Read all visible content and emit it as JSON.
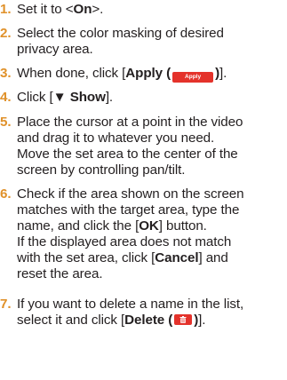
{
  "steps": [
    {
      "number": "1.",
      "text_before": "Set it to <",
      "bold": "On",
      "text_after": ">."
    },
    {
      "number": "2.",
      "lines": [
        "Select the color masking of desired",
        "privacy area."
      ]
    },
    {
      "number": "3.",
      "text_before": "When done, click [",
      "bold": "Apply (",
      "button_label": "Apply",
      "bold_after": ")",
      "text_after": "]."
    },
    {
      "number": "4.",
      "text_before": "Click [",
      "bold": "▼ Show",
      "text_after": "]."
    },
    {
      "number": "5.",
      "lines": [
        "Place the cursor at a point in the video",
        "and drag it to whatever you need.",
        "Move the set area to the center of the",
        "screen by controlling pan/tilt."
      ]
    },
    {
      "number": "6.",
      "line1": "Check if the area shown on the screen",
      "line2": "matches with the target area, type the",
      "line3_before": "name, and click the [",
      "line3_bold": "OK",
      "line3_after": "] button.",
      "line4": "If the displayed area does not match",
      "line5_before": "with the set area, click [",
      "line5_bold": "Cancel",
      "line5_after": "] and",
      "line6": "reset the area."
    },
    {
      "number": "7.",
      "line1": "If you want to delete a name in the list,",
      "line2_before": "select it and click [",
      "line2_bold": "Delete (",
      "line2_icon": "trash-icon",
      "line2_bold_after": ")",
      "line2_after": "]."
    }
  ],
  "colors": {
    "number": "#e0912a",
    "button": "#e4322b",
    "text": "#231f20"
  }
}
